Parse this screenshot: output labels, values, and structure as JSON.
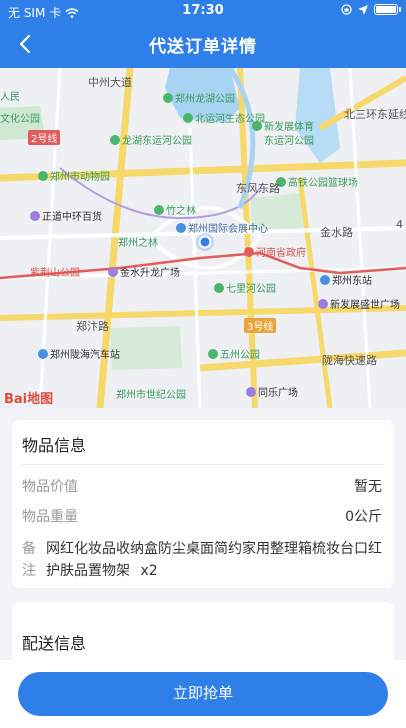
{
  "status_bar": {
    "carrier": "无 SIM 卡",
    "time": "17:30"
  },
  "nav": {
    "title": "代送订单详情"
  },
  "map": {
    "pois": {
      "longhu": "郑州龙湖公园",
      "yunhe_north": "北运河生态公园",
      "dongfeng_canal": "龙湖东运河公园",
      "sports": "新发展体育",
      "new_canal": "东运河公园",
      "beisan": "北三环东延线",
      "zoo": "郑州市动物园",
      "gaotie": "高铁公园篮球场",
      "zhuzhi": "竹之林",
      "center": "郑州国际会展中心",
      "zhengdao": "正道中环百货",
      "zhilin": "郑州之林",
      "hesheng": "河南省政府",
      "jinshui_road": "金水路",
      "hengshan": "紫荆山公园",
      "jinshui_square": "金水升龙广场",
      "qixing": "七里河公园",
      "east_station": "郑州东站",
      "new_sq": "新发展盛世广场",
      "zhengbian": "郑汴路",
      "longhai_station": "郑州陇海汽车站",
      "wuzhou": "五州公园",
      "longhai_road": "陇海快速路",
      "shiji": "郑州市世纪公园",
      "tongle": "同乐广场",
      "dongfeng_road": "东风东路",
      "zhongzhou": "中州大道",
      "cultural": "文化公园",
      "renmin": "人民",
      "line2": "2号线",
      "line3": "3号线",
      "road4": "4"
    },
    "logo": "Bai地图"
  },
  "goods": {
    "title": "物品信息",
    "value_label": "物品价值",
    "value": "暂无",
    "weight_label": "物品重量",
    "weight": "0公斤",
    "note_label": "备注",
    "note": "网红化妆品收纳盒防尘桌面简约家用整理箱梳妆台口红护肤品置物架",
    "qty": "x2"
  },
  "delivery": {
    "title": "配送信息"
  },
  "action": {
    "label": "立即抢单"
  },
  "colors": {
    "primary": "#2f7fe8",
    "park": "#4bb56b",
    "metro": "#e25c5c"
  }
}
